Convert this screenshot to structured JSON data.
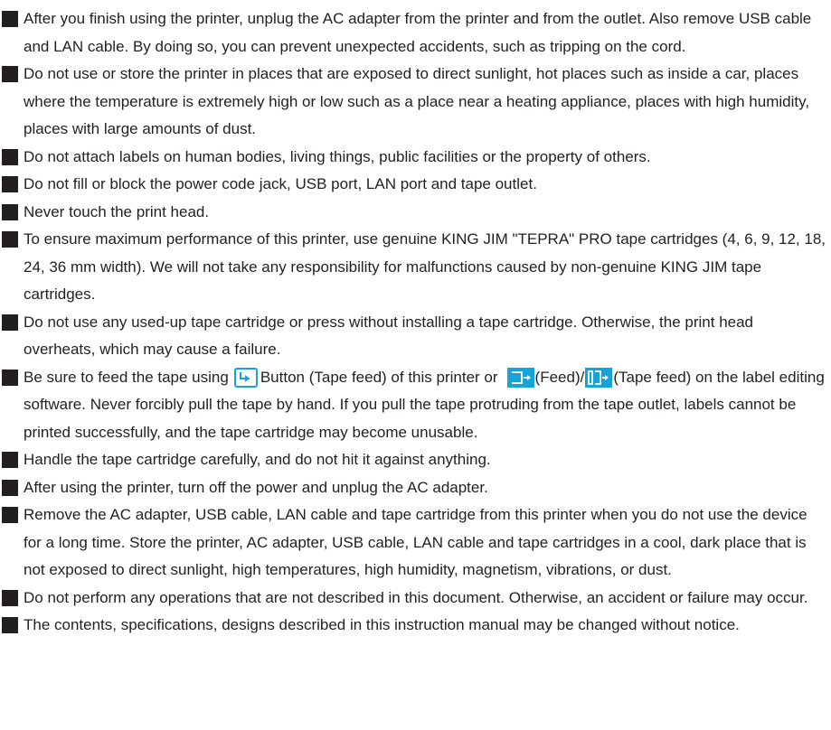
{
  "items": [
    "After you finish using the printer, unplug the AC adapter from the printer and from the outlet. Also remove USB cable and LAN cable. By doing so, you can prevent unexpected accidents, such as tripping on the cord.",
    "Do not use or store the printer in places that are exposed to direct sunlight, hot places such as inside a car, places where the temperature is extremely high or low such as a place near a heating appliance, places with high humidity, places with large amounts of dust.",
    "Do not attach labels on human bodies, living things, public facilities or the property of others.",
    "Do not fill or block the power code jack, USB port, LAN port and tape outlet.",
    "Never touch the print head.",
    "To ensure maximum performance of this printer, use genuine KING JIM \"TEPRA\" PRO tape cartridges (4, 6, 9, 12, 18, 24, 36 mm width). We will not take any responsibility for malfunctions caused by non-genuine KING JIM tape cartridges.",
    "Do not use any used-up tape cartridge or press without installing a tape cartridge. Otherwise, the print head overheats, which may cause a failure."
  ],
  "feed_item": {
    "part1": "Be sure to feed the tape using",
    "part2": "Button (Tape feed) of this printer or",
    "part3": "(Feed)/",
    "part4": "(Tape feed) on the label editing software. Never forcibly pull the tape by hand. If you pull the tape protruding from the tape outlet, labels cannot be printed successfully, and the tape cartridge may become unusable."
  },
  "items_after": [
    "Handle the tape cartridge carefully, and do not hit it against anything.",
    "After using the printer, turn off the power and unplug the AC adapter.",
    "Remove the AC adapter, USB cable, LAN cable and tape cartridge from this printer when you do not use the device for a long time. Store the printer, AC adapter, USB cable, LAN cable and tape cartridges in a cool, dark place that is not exposed to direct sunlight, high temperatures, high humidity, magnetism, vibrations, or dust.",
    "Do not perform any operations that are not described in this document. Otherwise, an accident or failure may occur.",
    "The contents, specifications, designs described in this instruction manual may be changed without notice."
  ],
  "icons": {
    "feed_button": "tape-feed-button-icon",
    "feed": "feed-icon",
    "tape_feed": "tape-feed-icon",
    "accent": "#16a3d8"
  }
}
